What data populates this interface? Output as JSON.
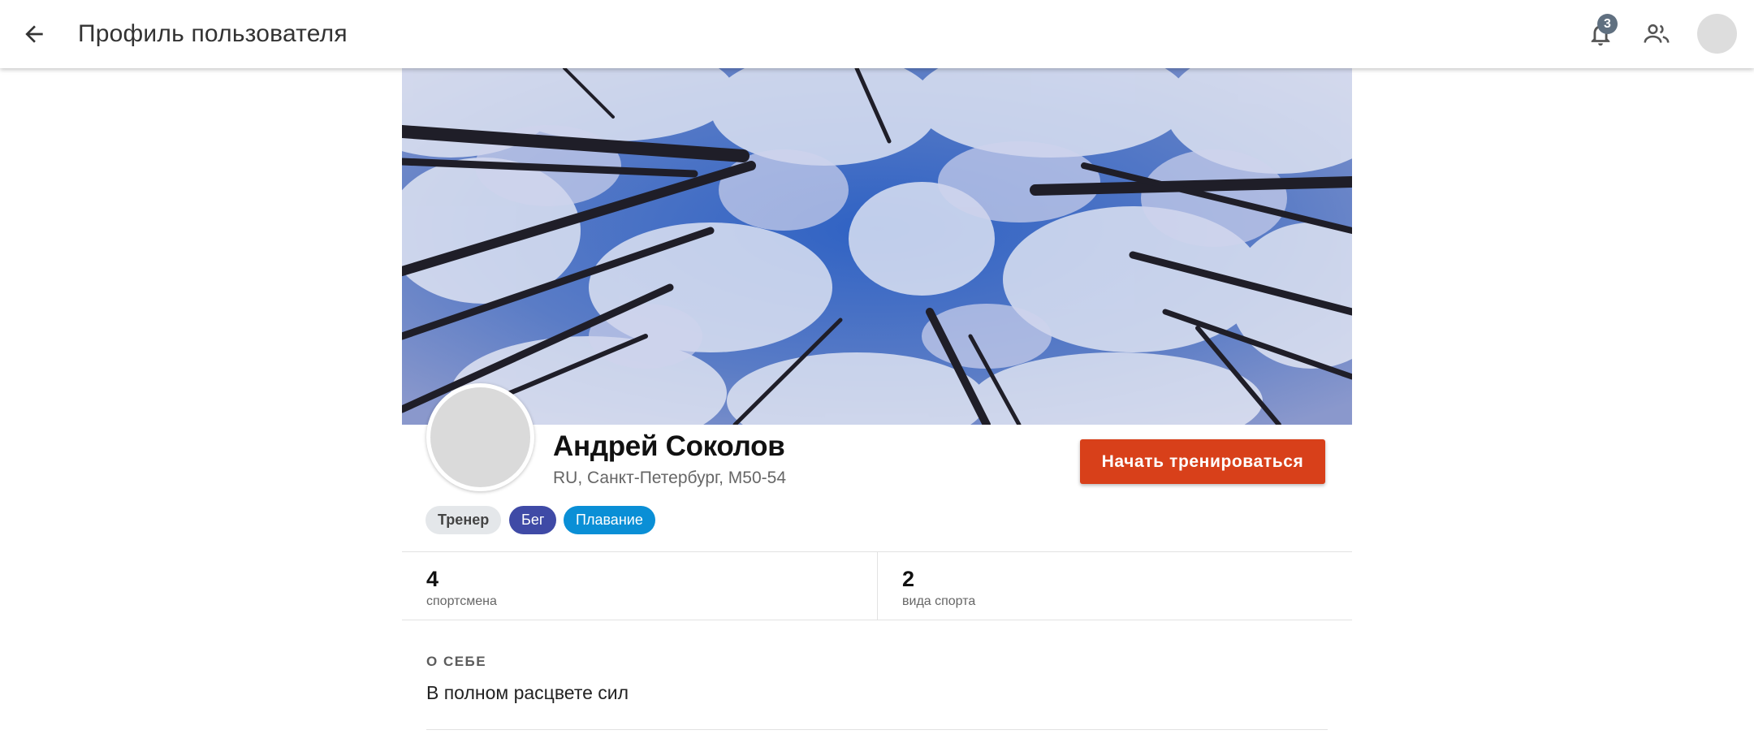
{
  "appbar": {
    "title": "Профиль пользователя",
    "notification_count": "3",
    "icons": {
      "back": "arrow-back-icon",
      "notifications": "bell-icon",
      "friends": "people-icon"
    }
  },
  "profile": {
    "name": "Андрей Соколов",
    "location": "RU, Санкт-Петербург, M50-54",
    "train_button": "Начать тренироваться",
    "tags": [
      {
        "label": "Тренер",
        "color": "#e4e7ea"
      },
      {
        "label": "Бег",
        "color": "#3f4aa6"
      },
      {
        "label": "Плавание",
        "color": "#0a8fd6"
      }
    ]
  },
  "stats": [
    {
      "value": "4",
      "label": "спортсмена"
    },
    {
      "value": "2",
      "label": "вида спорта"
    }
  ],
  "about": {
    "heading": "О СЕБЕ",
    "text": "В полном расцвете сил"
  },
  "colors": {
    "accent": "#d8401a",
    "badge": "#607080"
  }
}
